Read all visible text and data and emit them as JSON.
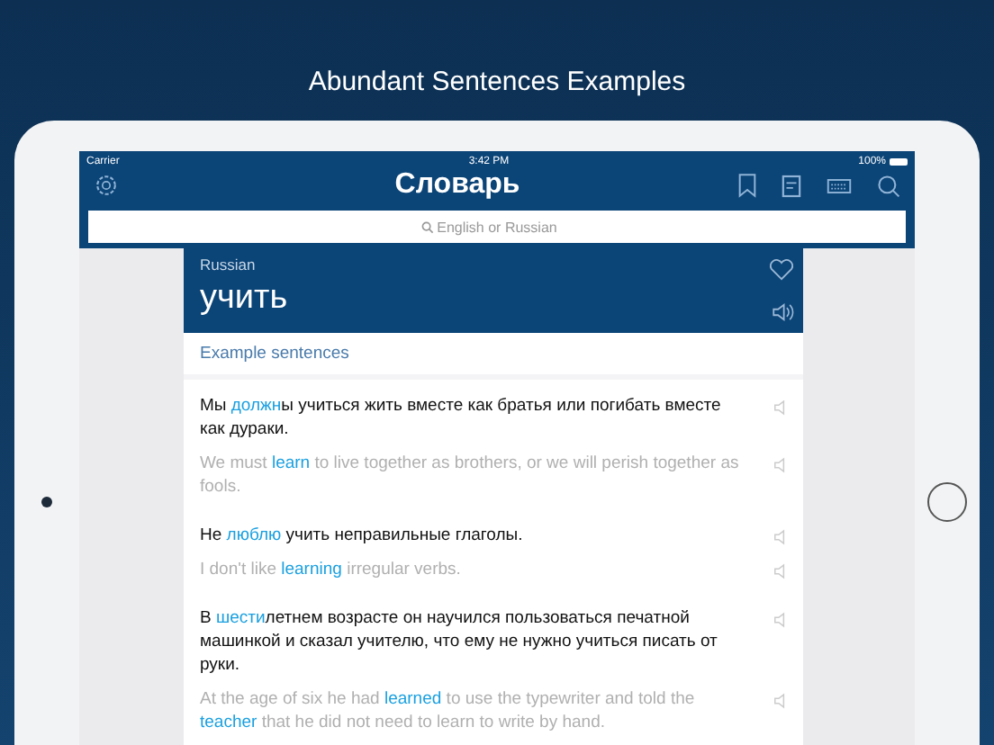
{
  "headline": "Abundant Sentences Examples",
  "status_bar": {
    "carrier": "Carrier",
    "time": "3:42 PM",
    "battery": "100%"
  },
  "nav": {
    "title": "Словарь"
  },
  "search": {
    "placeholder": "English or Russian"
  },
  "entry": {
    "language": "Russian",
    "word": "учить"
  },
  "section_title": "Example sentences",
  "sentences": [
    {
      "ru": [
        {
          "text": "Мы ",
          "highlight": false
        },
        {
          "text": "должн",
          "highlight": true
        },
        {
          "text": "ы учиться жить вместе как братья или погибать вместе как дураки.",
          "highlight": false
        }
      ],
      "en": [
        {
          "text": "We must ",
          "highlight": false
        },
        {
          "text": "learn",
          "highlight": true
        },
        {
          "text": " to live together as brothers, or we will perish together as fools.",
          "highlight": false
        }
      ]
    },
    {
      "ru": [
        {
          "text": "Не ",
          "highlight": false
        },
        {
          "text": "люблю",
          "highlight": true
        },
        {
          "text": " учить неправильные глаголы.",
          "highlight": false
        }
      ],
      "en": [
        {
          "text": "I don't like ",
          "highlight": false
        },
        {
          "text": "learning",
          "highlight": true
        },
        {
          "text": " irregular verbs.",
          "highlight": false
        }
      ]
    },
    {
      "ru": [
        {
          "text": "В ",
          "highlight": false
        },
        {
          "text": "шести",
          "highlight": true
        },
        {
          "text": "летнем возрасте он научился пользоваться печатной машинкой и сказал учителю, что ему не нужно учиться писать от руки.",
          "highlight": false
        }
      ],
      "en": [
        {
          "text": "At the age of six he had ",
          "highlight": false
        },
        {
          "text": "learned",
          "highlight": true
        },
        {
          "text": " to use the typewriter and told the ",
          "highlight": false
        },
        {
          "text": "teacher",
          "highlight": true
        },
        {
          "text": " that he did not need to learn to write by hand.",
          "highlight": false
        }
      ]
    }
  ]
}
